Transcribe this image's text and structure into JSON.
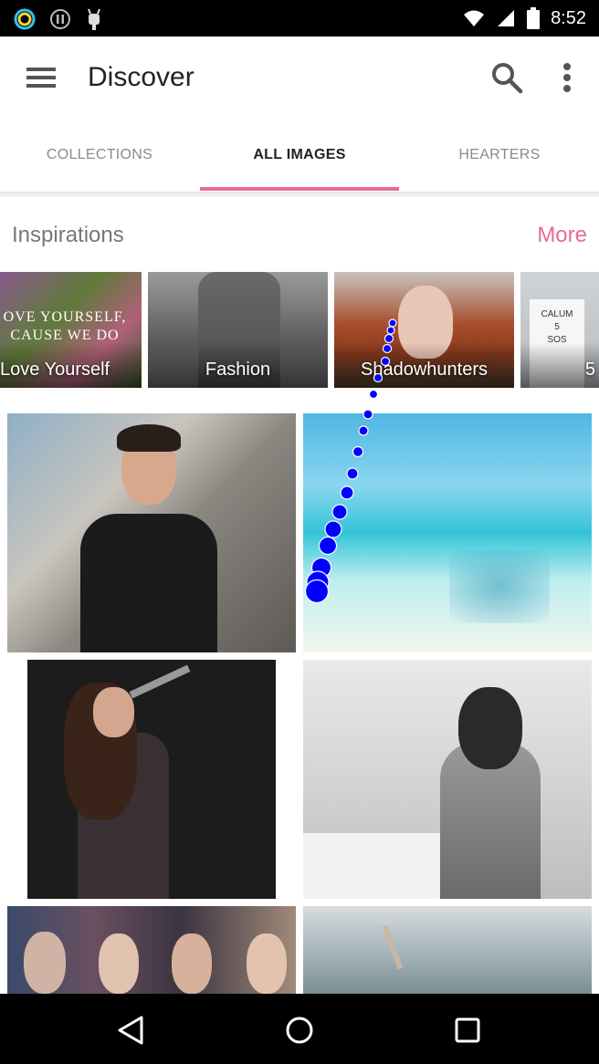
{
  "status_bar": {
    "time": "8:52",
    "left_icons": [
      "ring-app-icon",
      "pause-circle-icon",
      "android-icon"
    ],
    "right_icons": [
      "wifi-icon",
      "signal-icon",
      "battery-icon"
    ]
  },
  "app_bar": {
    "title": "Discover",
    "icons": [
      "menu-icon",
      "search-icon",
      "more-vert-icon"
    ]
  },
  "tabs": [
    {
      "label": "COLLECTIONS",
      "active": false
    },
    {
      "label": "ALL IMAGES",
      "active": true
    },
    {
      "label": "HEARTERS",
      "active": false
    }
  ],
  "inspirations": {
    "title": "Inspirations",
    "more_label": "More",
    "collections": [
      {
        "label": "Love Yourself",
        "overlay_text": "OVE YOURSELF, CAUSE WE DO"
      },
      {
        "label": "Fashion"
      },
      {
        "label": "Shadowhunters"
      },
      {
        "label": "5",
        "overlay_text": "CALUM 5 SOS"
      }
    ]
  },
  "nav_bar": {
    "icons": [
      "back-icon",
      "home-icon",
      "recents-icon"
    ]
  },
  "colors": {
    "accent": "#e86a9a",
    "tab_active": "#222222",
    "tab_inactive": "#8a8a8a",
    "touch_trail": "#0000ff"
  }
}
